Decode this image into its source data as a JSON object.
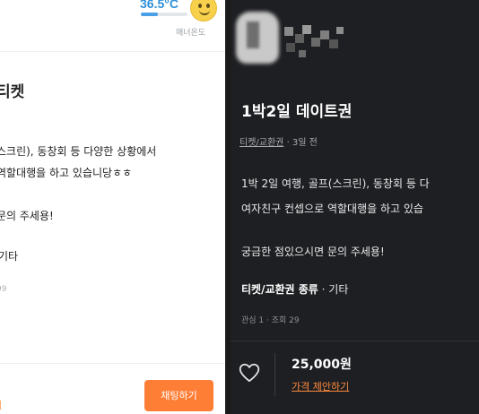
{
  "left_panel": {
    "temperature": "36.5°C",
    "temperature_level": 0.365,
    "manner_label": "매너온도",
    "title": "티켓",
    "body_line1": "스크린), 동창회 등 다양한 상황에서",
    "body_line2": "역할대행을 하고 있습니당ㅎㅎ",
    "body_line3": "문의 주세용!",
    "category": "기타",
    "stats": "99",
    "propose_label": "기",
    "chat_button": "채팅하기"
  },
  "right_panel": {
    "title": "1박2일 데이트권",
    "category_link": "티켓/교환권",
    "time_ago": "· 3일 전",
    "body_line1": "1박 2일 여행, 골프(스크린), 동창회 등 다",
    "body_line2": "여자친구 컨셉으로 역할대행을 하고 있습",
    "body_line3": "궁금한 점있으시면 문의 주세용!",
    "category_label": "티켓/교환권 종류",
    "category_value": "· 기타",
    "stats": "관심 1 · 조회 29",
    "price": "25,000원",
    "propose_label": "가격 제안하기"
  },
  "colors": {
    "accent_orange": "#ff7e36",
    "temp_blue": "#2f8fd8",
    "dark_bg": "#1e1f22"
  },
  "icons": {
    "smiley": "smiley-face-icon",
    "heart": "heart-outline-icon",
    "avatar": "blurred-avatar"
  }
}
